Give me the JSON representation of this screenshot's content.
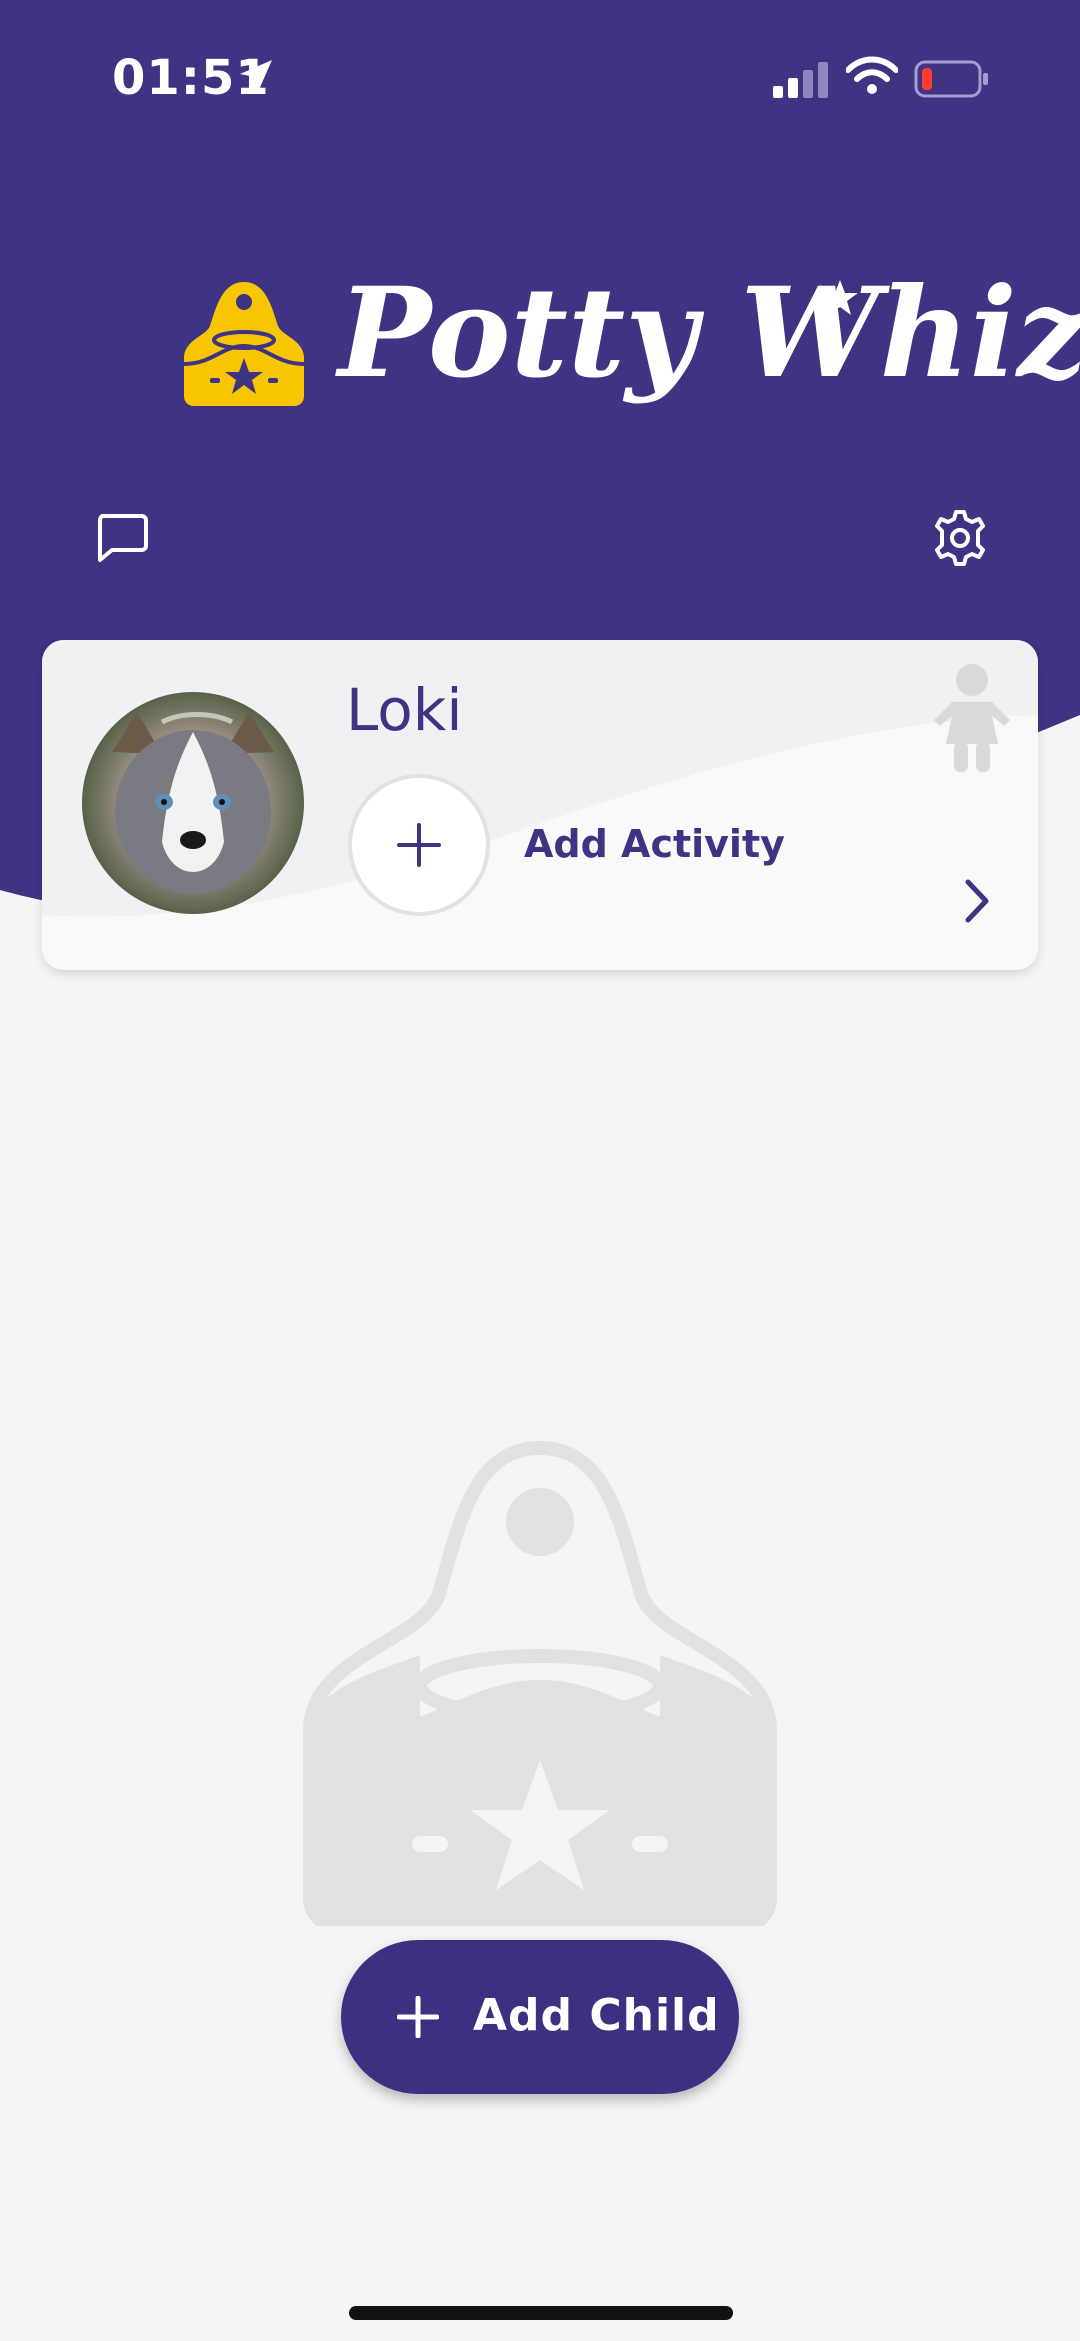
{
  "status_bar": {
    "time": "01:51",
    "icons": [
      "location-arrow-icon",
      "signal-icon",
      "wifi-icon",
      "battery-low-icon"
    ]
  },
  "header": {
    "app_title": "Potty Whiz",
    "logo_icon": "potty-logo-icon",
    "left_icon": "chat-bubble-icon",
    "right_icon": "gear-icon"
  },
  "child_card": {
    "name": "Loki",
    "add_activity_label": "Add Activity",
    "avatar_icon": "child-avatar-photo",
    "gender_icon": "girl-icon",
    "chevron_icon": "chevron-right-icon"
  },
  "add_child": {
    "label": "Add Child",
    "icon": "plus-icon"
  },
  "colors": {
    "primary": "#3f3384",
    "accent": "#f7c600",
    "background": "#f5f5f6"
  }
}
